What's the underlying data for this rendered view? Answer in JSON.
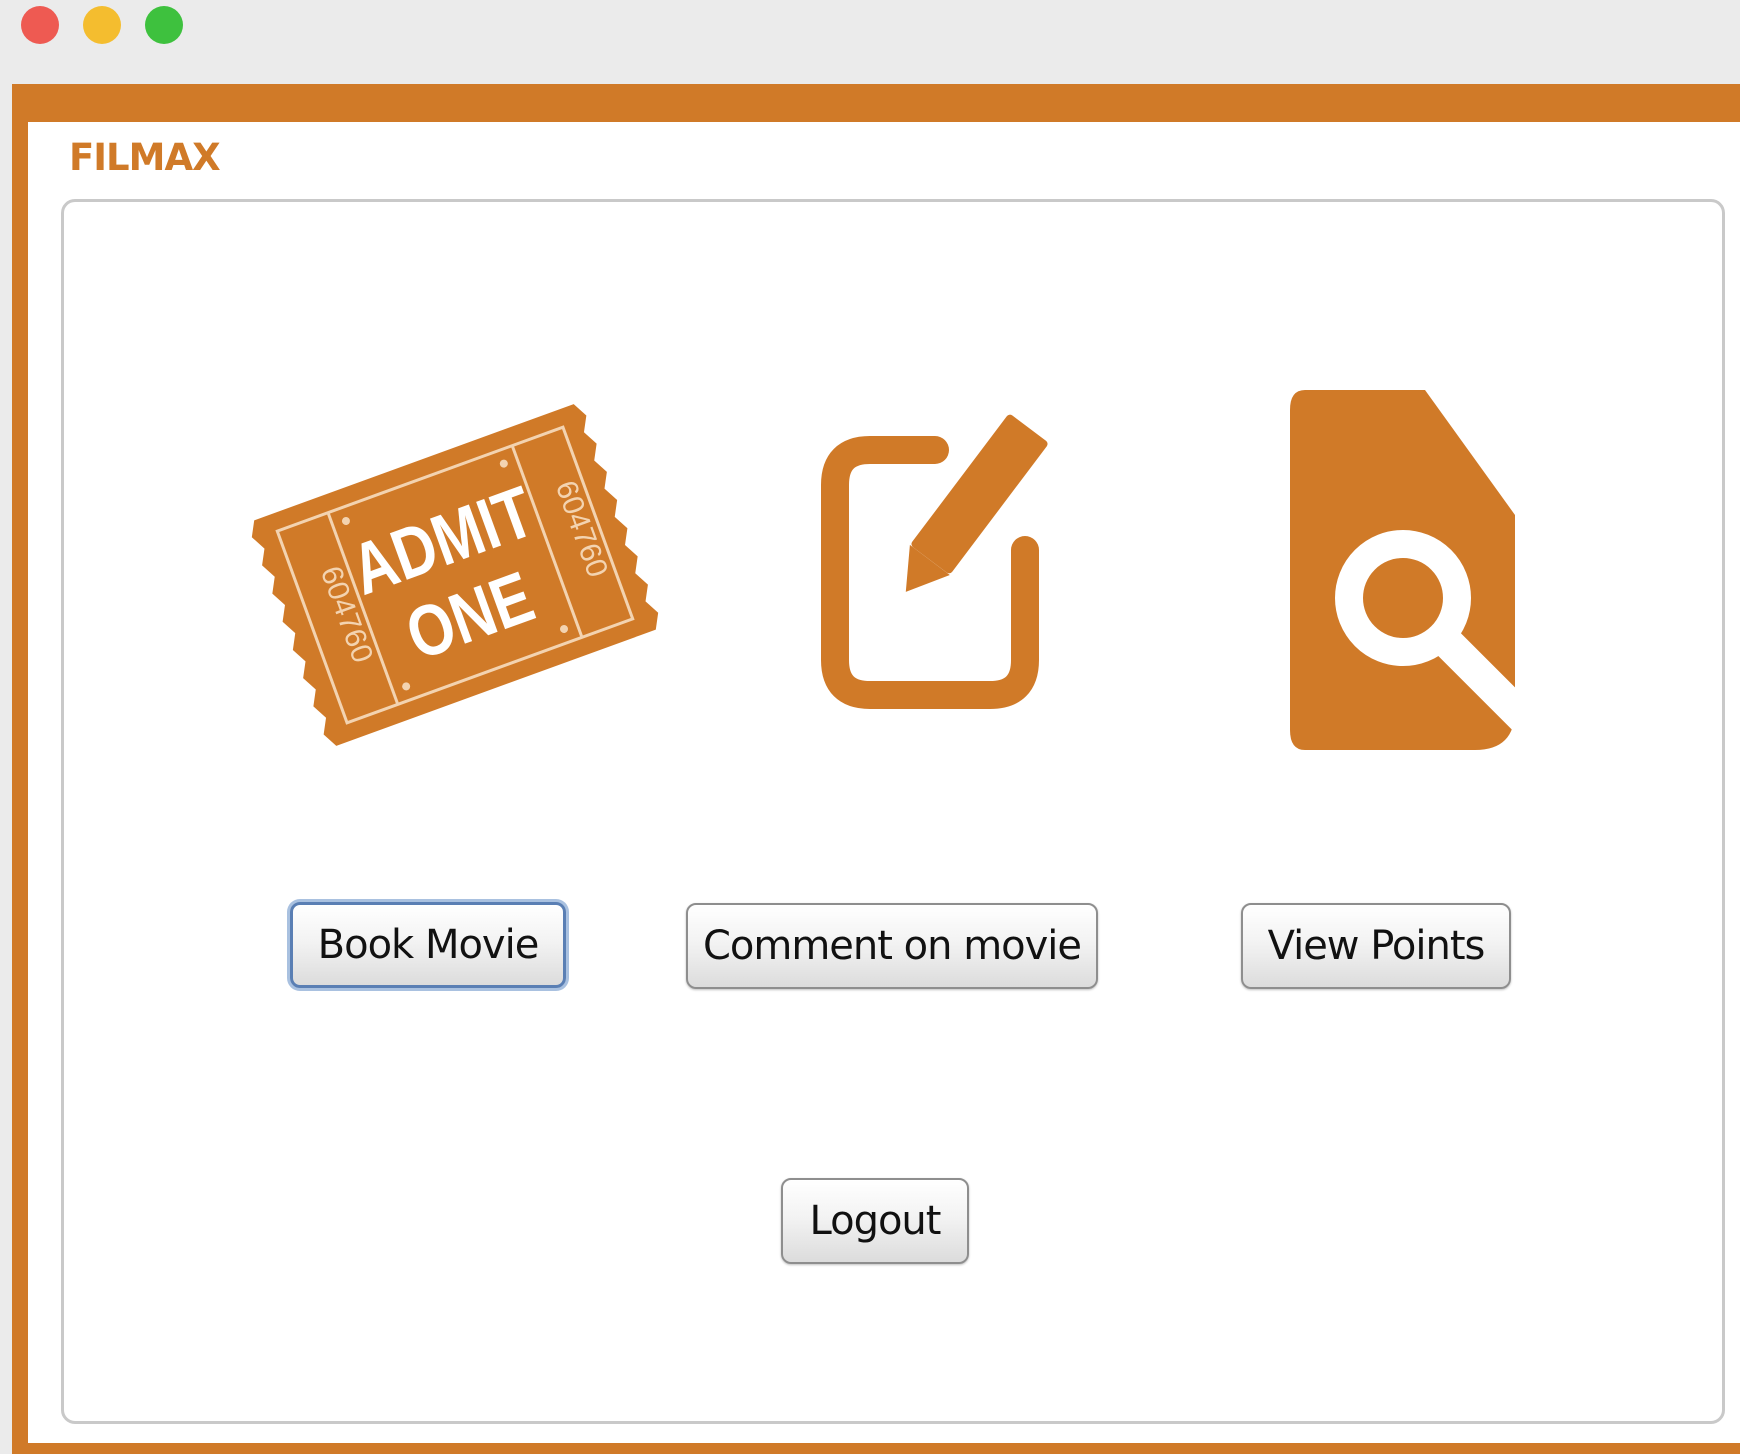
{
  "window": {
    "controls": {
      "close": "close-dot",
      "minimize": "minimize-dot",
      "zoom": "zoom-dot"
    },
    "accent_color": "#d07a28"
  },
  "app": {
    "title": "FILMAX"
  },
  "ticket_icon": {
    "line1": "ADMIT",
    "line2": "ONE",
    "serial": "604760"
  },
  "actions": {
    "book_label": "Book Movie",
    "comment_label": "Comment on movie",
    "points_label": "View Points",
    "logout_label": "Logout"
  }
}
